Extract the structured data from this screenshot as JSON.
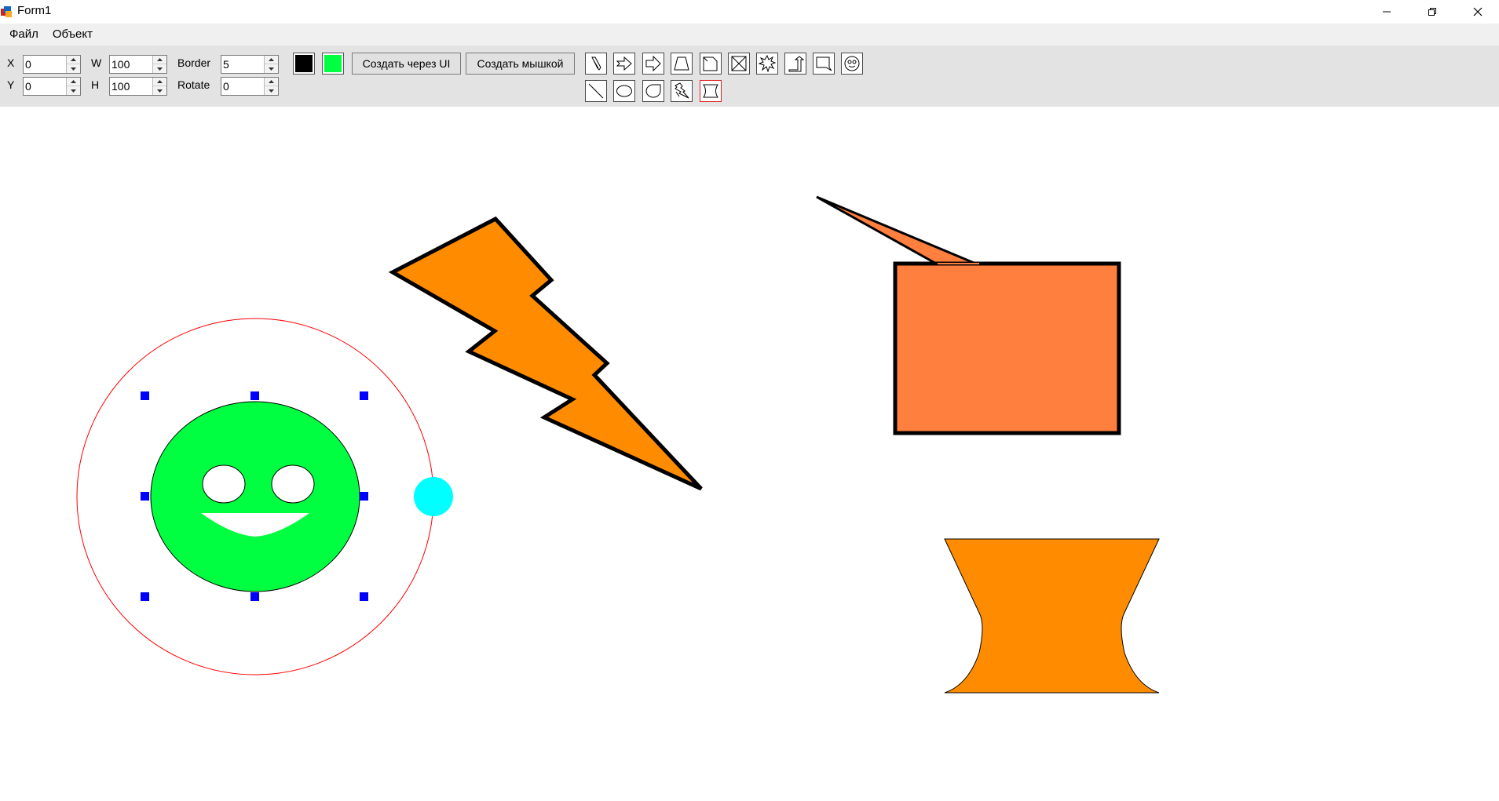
{
  "window": {
    "title": "Form1",
    "controls": {
      "minimize": "minimize-icon",
      "restore": "restore-icon",
      "close": "close-icon"
    }
  },
  "menu": {
    "items": [
      {
        "label": "Файл"
      },
      {
        "label": "Объект"
      }
    ]
  },
  "properties": {
    "x": {
      "label": "X",
      "value": "0"
    },
    "y": {
      "label": "Y",
      "value": "0"
    },
    "w": {
      "label": "W",
      "value": "100"
    },
    "h": {
      "label": "H",
      "value": "100"
    },
    "border": {
      "label": "Border",
      "value": "5"
    },
    "rotate": {
      "label": "Rotate",
      "value": "0"
    }
  },
  "colors": {
    "border_color": "#000000",
    "fill_color": "#00ff40",
    "selection_circle": "#ff0000",
    "handles": "#0000ff",
    "rotate_handle": "#00ffff",
    "orange": "#ff8c00",
    "coral": "#ff7f3f"
  },
  "buttons": {
    "create_ui": "Создать через UI",
    "create_mouse": "Создать мышкой"
  },
  "tools": {
    "row1": [
      "pencil-icon",
      "arrow-right-outline-icon",
      "arrow-right-icon",
      "trapezoid-icon",
      "cut-corner-rect-icon",
      "bowtie-icon",
      "explosion-icon",
      "elbow-arrow-icon",
      "callout-rect-icon",
      "smiley-icon"
    ],
    "row2": [
      "line-icon",
      "ellipse-icon",
      "teardrop-icon",
      "lightning-icon",
      "concave-rect-icon"
    ],
    "selected": "concave-rect-icon"
  },
  "shapes": [
    {
      "type": "smiley",
      "fill": "#00ff40",
      "selected": true
    },
    {
      "type": "lightning",
      "fill": "#ff8c00",
      "border_width": 5
    },
    {
      "type": "callout-rectangle",
      "fill": "#ff7f3f",
      "border_width": 5
    },
    {
      "type": "concave-rectangle",
      "fill": "#ff8c00",
      "border_width": 1
    }
  ]
}
